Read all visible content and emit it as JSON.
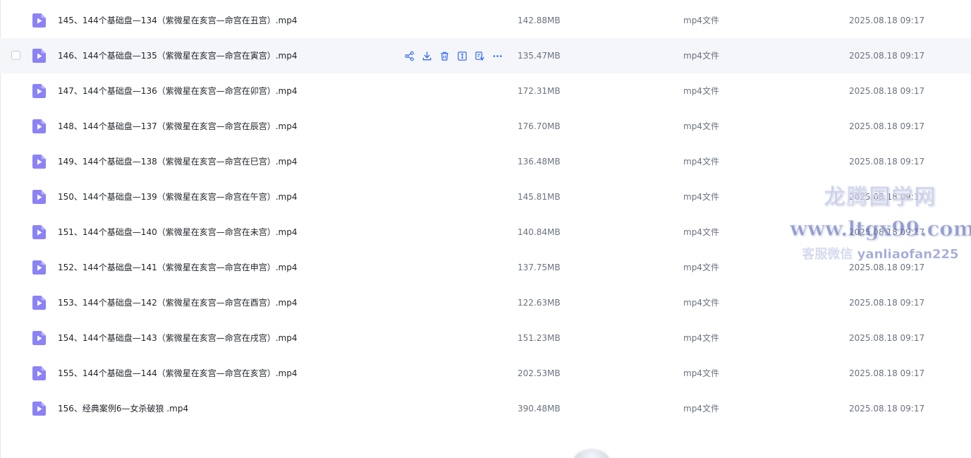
{
  "files": [
    {
      "name": "145、144个基础盘—134（紫微星在亥宫—命宫在丑宫）.mp4",
      "size": "142.88MB",
      "type": "mp4文件",
      "date": "2025.08.18 09:17"
    },
    {
      "name": "146、144个基础盘—135（紫微星在亥宫—命宫在寅宫）.mp4",
      "size": "135.47MB",
      "type": "mp4文件",
      "date": "2025.08.18 09:17",
      "hovered": true
    },
    {
      "name": "147、144个基础盘—136（紫微星在亥宫—命宫在卯宫）.mp4",
      "size": "172.31MB",
      "type": "mp4文件",
      "date": "2025.08.18 09:17"
    },
    {
      "name": "148、144个基础盘—137（紫微星在亥宫—命宫在辰宫）.mp4",
      "size": "176.70MB",
      "type": "mp4文件",
      "date": "2025.08.18 09:17"
    },
    {
      "name": "149、144个基础盘—138（紫微星在亥宫—命宫在巳宫）.mp4",
      "size": "136.48MB",
      "type": "mp4文件",
      "date": "2025.08.18 09:17"
    },
    {
      "name": "150、144个基础盘—139（紫微星在亥宫—命宫在午宫）.mp4",
      "size": "145.81MB",
      "type": "mp4文件",
      "date": "2025.08.18 09:17"
    },
    {
      "name": "151、144个基础盘—140（紫微星在亥宫—命宫在未宫）.mp4",
      "size": "140.84MB",
      "type": "mp4文件",
      "date": "2025.08.18 09:17"
    },
    {
      "name": "152、144个基础盘—141（紫微星在亥宫—命宫在申宫）.mp4",
      "size": "137.75MB",
      "type": "mp4文件",
      "date": "2025.08.18 09:17"
    },
    {
      "name": "153、144个基础盘—142（紫微星在亥宫—命宫在酉宫）.mp4",
      "size": "122.63MB",
      "type": "mp4文件",
      "date": "2025.08.18 09:17"
    },
    {
      "name": "154、144个基础盘—143（紫微星在亥宫—命宫在戌宫）.mp4",
      "size": "151.23MB",
      "type": "mp4文件",
      "date": "2025.08.18 09:17"
    },
    {
      "name": "155、144个基础盘—144（紫微星在亥宫—命宫在亥宫）.mp4",
      "size": "202.53MB",
      "type": "mp4文件",
      "date": "2025.08.18 09:17"
    },
    {
      "name": "156、经典案例6—女杀破狼 .mp4",
      "size": "390.48MB",
      "type": "mp4文件",
      "date": "2025.08.18 09:17"
    }
  ],
  "row_actions": [
    "share-icon",
    "download-icon",
    "delete-icon",
    "rename-icon",
    "copy-icon",
    "more-icon"
  ],
  "watermark": {
    "line1": "龙腾国学网",
    "line2": "www.ltgx99.com",
    "line3": "客服微信 yanliaofan225"
  },
  "colors": {
    "accent": "#2f6bff",
    "file_icon": "#8b82f6",
    "row_hover": "#f5f6fa"
  }
}
